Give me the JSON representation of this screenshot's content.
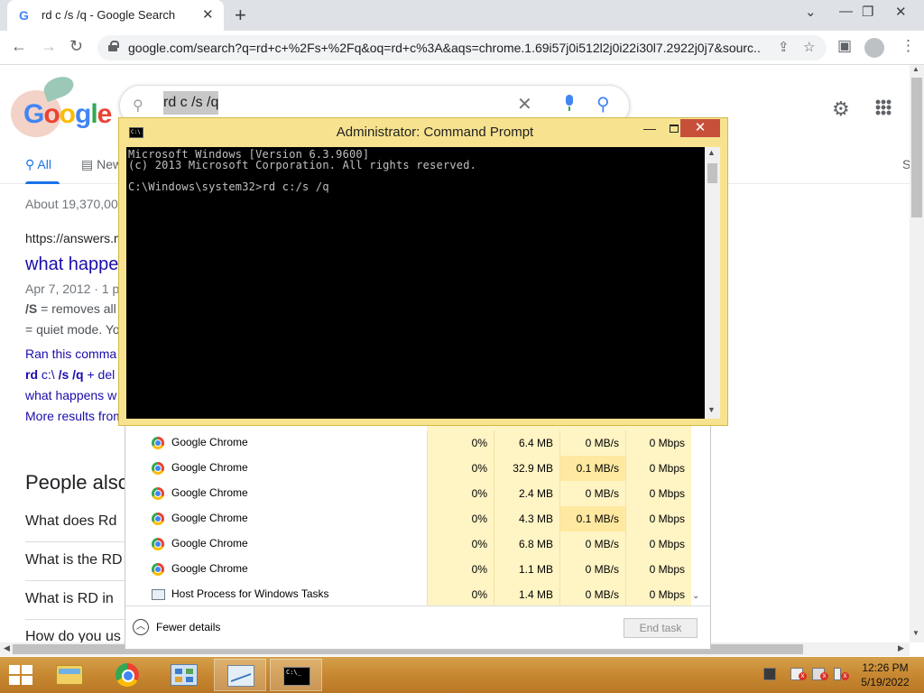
{
  "browser": {
    "tab_title": "rd c /s /q - Google Search",
    "tab_icon": "G",
    "url": "google.com/search?q=rd+c+%2Fs+%2Fq&oq=rd+c%3A&aqs=chrome.1.69i57j0i512l2j0i22i30l7.2922j0j7&sourc..."
  },
  "google": {
    "search_query": "rd c /s /q",
    "tabs": [
      {
        "label": "All"
      },
      {
        "label": "New"
      },
      {
        "label": "S"
      }
    ],
    "result_stats": "About 19,370,00",
    "result": {
      "cite": "https://answers.m",
      "title": "what happe",
      "date": "Apr 7, 2012 · 1 p",
      "snippet_1_bold": "/S",
      "snippet_1": " = removes all",
      "snippet_2": "= quiet mode. Yo"
    },
    "sitelinks": [
      {
        "label": "Ran this comma"
      },
      {
        "bold_a": "rd",
        "plain_a": " c",
        "plain_b": ":\\ ",
        "bold_b": "/s",
        "plain_c": " ",
        "bold_c": "/q",
        "plain_d": " + del "
      },
      {
        "label": "what happens w"
      }
    ],
    "more_results": "More results from",
    "people_also_ask": {
      "title": "People also",
      "questions": [
        {
          "label": "What does Rd"
        },
        {
          "label": "What is the RD"
        },
        {
          "label": "What is RD in"
        },
        {
          "label": "How do you us"
        }
      ]
    }
  },
  "task_manager": {
    "rows": [
      {
        "name": "Google Chrome",
        "icon": "chrome-icon",
        "cpu": "0%",
        "memory": "6.4 MB",
        "disk": "0 MB/s",
        "network": "0 Mbps"
      },
      {
        "name": "Google Chrome",
        "icon": "chrome-icon",
        "cpu": "0%",
        "memory": "32.9 MB",
        "disk": "0.1 MB/s",
        "network": "0 Mbps"
      },
      {
        "name": "Google Chrome",
        "icon": "chrome-icon",
        "cpu": "0%",
        "memory": "2.4 MB",
        "disk": "0 MB/s",
        "network": "0 Mbps"
      },
      {
        "name": "Google Chrome",
        "icon": "chrome-icon",
        "cpu": "0%",
        "memory": "4.3 MB",
        "disk": "0.1 MB/s",
        "network": "0 Mbps"
      },
      {
        "name": "Google Chrome",
        "icon": "chrome-icon",
        "cpu": "0%",
        "memory": "6.8 MB",
        "disk": "0 MB/s",
        "network": "0 Mbps"
      },
      {
        "name": "Google Chrome",
        "icon": "chrome-icon",
        "cpu": "0%",
        "memory": "1.1 MB",
        "disk": "0 MB/s",
        "network": "0 Mbps"
      },
      {
        "name": "Host Process for Windows Tasks",
        "icon": "host-process-icon",
        "cpu": "0%",
        "memory": "1.4 MB",
        "disk": "0 MB/s",
        "network": "0 Mbps"
      }
    ],
    "fewer_details": "Fewer details",
    "end_task": "End task"
  },
  "cmd": {
    "title": "Administrator: Command Prompt",
    "lines": [
      "Microsoft Windows [Version 6.3.9600]",
      "(c) 2013 Microsoft Corporation. All rights reserved.",
      "",
      "C:\\Windows\\system32>rd c:/s /q"
    ]
  },
  "taskbar": {
    "time": "12:26 PM",
    "date": "5/19/2022"
  }
}
